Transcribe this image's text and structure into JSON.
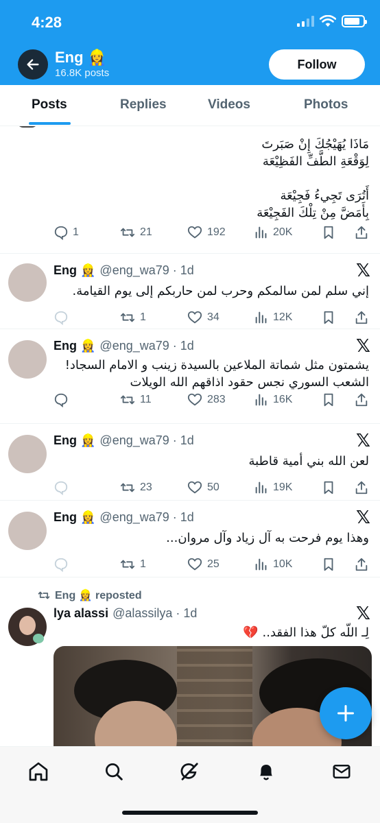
{
  "status_bar": {
    "time": "4:28",
    "battery_level": 0.85
  },
  "header": {
    "name": "Eng 👷‍♀️",
    "posts_count": "16.8K posts",
    "follow_label": "Follow"
  },
  "tabs": [
    {
      "label": "Posts",
      "active": true
    },
    {
      "label": "Replies",
      "active": false
    },
    {
      "label": "Videos",
      "active": false
    },
    {
      "label": "Photos",
      "active": false
    }
  ],
  "posts": [
    {
      "lines": [
        "مَاذَا يُهَيْجُكَ إِنْ صَبَرتَ",
        "لِوَقْعَةِ الطَّفِّ الفَظِيْعَة",
        "",
        "أَتُرَى تَجِيءُ فَجِيْعَة",
        "بِأَمَضَّ مِنْ تِلْكَ الفَجِيْعَة"
      ],
      "replies": "1",
      "reposts": "21",
      "likes": "192",
      "views": "20K"
    },
    {
      "name": "Eng 👷‍♀️",
      "handle": "@eng_wa79 · 1d",
      "lines": [
        "إني سلم لمن سالمكم وحرب لمن حاربكم إلى يوم القيامة."
      ],
      "replies": "",
      "reposts": "1",
      "likes": "34",
      "views": "12K"
    },
    {
      "name": "Eng 👷‍♀️",
      "handle": "@eng_wa79 · 1d",
      "lines": [
        "يشمتون مثل شماتة الملاعين بالسيدة زينب و الامام السجاد!",
        "الشعب السوري نجس حقود اذاقهم الله الويلات"
      ],
      "replies": "",
      "reposts": "11",
      "likes": "283",
      "views": "16K"
    },
    {
      "name": "Eng 👷‍♀️",
      "handle": "@eng_wa79 · 1d",
      "lines": [
        "لعن الله بني أمية قاطبة"
      ],
      "replies": "",
      "reposts": "23",
      "likes": "50",
      "views": "19K"
    },
    {
      "name": "Eng 👷‍♀️",
      "handle": "@eng_wa79 · 1d",
      "lines": [
        "وهذا يوم فرحت به آل زياد وآل مروان..."
      ],
      "replies": "",
      "reposts": "1",
      "likes": "25",
      "views": "10K"
    },
    {
      "repost_label": "Eng 👷‍♀️ reposted",
      "name": "lya alassi",
      "handle": "@alassilya · 1d",
      "lines": [
        "لِـ اللّه كلّ هذا الفقد.. 💔"
      ]
    }
  ],
  "icons": {
    "back": "arrow-left-icon",
    "reply": "reply-icon",
    "repost": "repost-icon",
    "like": "heart-icon",
    "views": "views-icon",
    "bookmark": "bookmark-icon",
    "share": "share-icon",
    "x_logo": "x-logo-icon",
    "compose": "plus-icon",
    "home": "home-icon",
    "search": "search-icon",
    "grok": "grok-icon",
    "notifications": "bell-icon",
    "messages": "mail-icon"
  },
  "colors": {
    "accent": "#1d9bf0",
    "text": "#0f1419",
    "muted": "#536471"
  }
}
